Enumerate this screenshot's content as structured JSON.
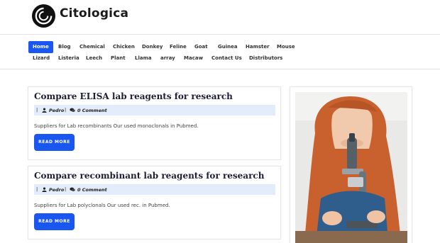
{
  "site": {
    "name": "Citologica"
  },
  "nav": {
    "items": [
      {
        "label": "Home",
        "active": true
      },
      {
        "label": "Blog"
      },
      {
        "label": "Chemical"
      },
      {
        "label": "Chicken"
      },
      {
        "label": "Donkey"
      },
      {
        "label": "Feline"
      },
      {
        "label": "Goat"
      },
      {
        "label": "Guinea"
      },
      {
        "label": "Hamster"
      },
      {
        "label": "Mouse"
      },
      {
        "label": "Lizard"
      },
      {
        "label": "Listeria"
      },
      {
        "label": "Leech"
      },
      {
        "label": "Plant"
      },
      {
        "label": "Llama"
      },
      {
        "label": "array"
      },
      {
        "label": "Macaw"
      },
      {
        "label": "Contact Us"
      },
      {
        "label": "Distributors"
      }
    ]
  },
  "posts": [
    {
      "title": "Compare ELISA lab reagents for research",
      "separator": "|",
      "author": "Pedro",
      "comments": "0 Comment",
      "excerpt": "Suppliers for Lab recombinants Our used monoclonals in Pubmed.",
      "button": "READ MORE"
    },
    {
      "title": "Compare recombinant lab reagents for research",
      "separator": "|",
      "author": "Pedro",
      "comments": "0 Comment",
      "excerpt": "Suppliers for Lab polyclonals Our used rec. in Pubmed.",
      "button": "READ MORE"
    }
  ],
  "colors": {
    "accent": "#1a56f0",
    "meta_bg": "#e3ecfb",
    "title": "#1d1d35"
  },
  "icons": {
    "logo": "circle-swirl-logo",
    "author": "user-icon",
    "comments": "comment-icon"
  }
}
